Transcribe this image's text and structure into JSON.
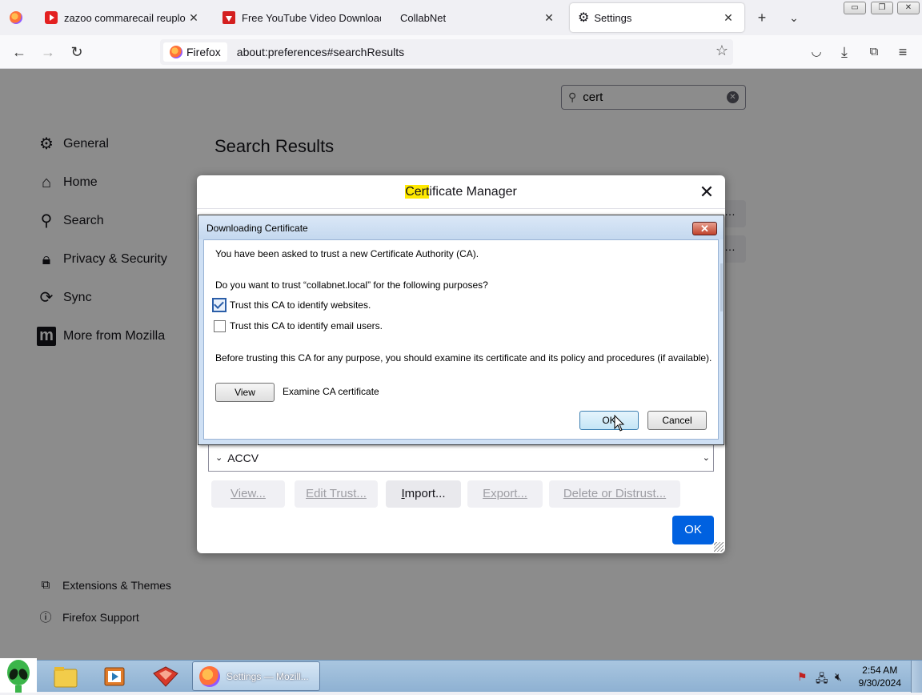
{
  "browser": {
    "tabs": [
      {
        "title": "zazoo commarecail reuploqd -",
        "icon": "youtube-icon",
        "active": false
      },
      {
        "title": "Free YouTube Video Download",
        "icon": "download-app-icon",
        "active": false
      },
      {
        "title": "CollabNet",
        "icon": "",
        "active": false
      },
      {
        "title": "Settings",
        "icon": "gear-icon",
        "active": true
      }
    ],
    "identity_label": "Firefox",
    "url": "about:preferences#searchResults"
  },
  "preferences": {
    "search_value": "cert",
    "categories": [
      {
        "label": "General",
        "icon": "gear-icon"
      },
      {
        "label": "Home",
        "icon": "home-icon"
      },
      {
        "label": "Search",
        "icon": "search-icon"
      },
      {
        "label": "Privacy & Security",
        "icon": "lock-icon"
      },
      {
        "label": "Sync",
        "icon": "sync-icon"
      },
      {
        "label": "More from Mozilla",
        "icon": "mozilla-icon"
      }
    ],
    "footer_links": [
      {
        "label": "Extensions & Themes",
        "icon": "puzzle-icon"
      },
      {
        "label": "Firefox Support",
        "icon": "help-icon"
      }
    ],
    "results_title": "Search Results"
  },
  "cert_manager": {
    "title_highlight": "Cert",
    "title_rest": "ificate Manager",
    "tree_item": "ACCV",
    "buttons": {
      "view": "View...",
      "edit_trust": "Edit Trust...",
      "import_u": "I",
      "import_rest": "mport...",
      "export": "Export...",
      "delete": "Delete or Distrust..."
    },
    "ok_label": "OK"
  },
  "download_dialog": {
    "title": "Downloading Certificate",
    "close_label": "✕",
    "intro": "You have been asked to trust a new Certificate Authority (CA).",
    "question": "Do you want to trust “collabnet.local” for the following purposes?",
    "purposes": [
      {
        "label": "Trust this CA to identify websites.",
        "checked": true
      },
      {
        "label": "Trust this CA to identify email users.",
        "checked": false
      }
    ],
    "advice": "Before trusting this CA for any purpose, you should examine its certificate and its policy and procedures (if available).",
    "view_label": "View",
    "examine_label": "Examine CA certificate",
    "ok_label": "OK",
    "cancel_label": "Cancel"
  },
  "taskbar": {
    "firefox_label": "Settings — Mozill...",
    "time": "2:54 AM",
    "date": "9/30/2024"
  }
}
